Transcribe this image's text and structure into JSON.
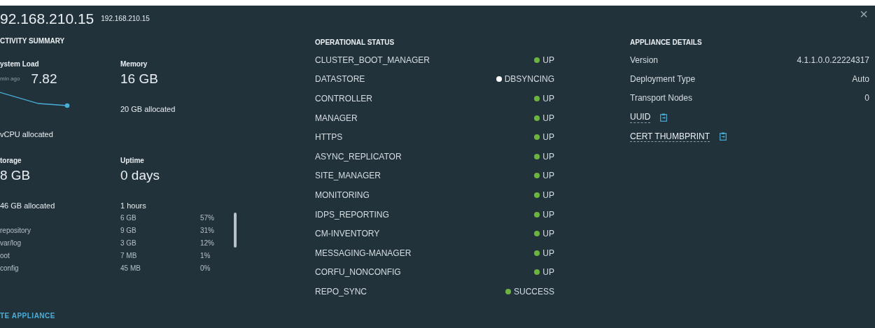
{
  "dialog": {
    "title": "92.168.210.15",
    "subtitle": "192.168.210.15",
    "close": "×"
  },
  "activity_summary": {
    "heading": "CTIVITY SUMMARY",
    "system_load": {
      "label": "ystem Load",
      "time": "min ago",
      "value": "7.82",
      "note": "vCPU allocated"
    },
    "memory": {
      "label": "Memory",
      "value": "16 GB",
      "note": "20 GB allocated"
    },
    "storage": {
      "label": "torage",
      "value": "8 GB",
      "note": "46 GB allocated"
    },
    "uptime": {
      "label": "Uptime",
      "value": "0 days",
      "note": "1 hours"
    },
    "partitions": [
      {
        "size": "6 GB",
        "percent": "57%"
      },
      {
        "name": "repository",
        "size": "9 GB",
        "percent": "31%"
      },
      {
        "name": "var/log",
        "size": "3 GB",
        "percent": "12%"
      },
      {
        "name": "oot",
        "size": "7 MB",
        "percent": "1%"
      },
      {
        "name": "config",
        "size": "45 MB",
        "percent": "0%"
      }
    ],
    "action": "TE APPLIANCE"
  },
  "operational_status": {
    "heading": "OPERATIONAL STATUS",
    "items": [
      {
        "name": "CLUSTER_BOOT_MANAGER",
        "status": "UP",
        "color": "#6db33f"
      },
      {
        "name": "DATASTORE",
        "status": "DBSYNCING",
        "color": "#ffffff"
      },
      {
        "name": "CONTROLLER",
        "status": "UP",
        "color": "#6db33f"
      },
      {
        "name": "MANAGER",
        "status": "UP",
        "color": "#6db33f"
      },
      {
        "name": "HTTPS",
        "status": "UP",
        "color": "#6db33f"
      },
      {
        "name": "ASYNC_REPLICATOR",
        "status": "UP",
        "color": "#6db33f"
      },
      {
        "name": "SITE_MANAGER",
        "status": "UP",
        "color": "#6db33f"
      },
      {
        "name": "MONITORING",
        "status": "UP",
        "color": "#6db33f"
      },
      {
        "name": "IDPS_REPORTING",
        "status": "UP",
        "color": "#6db33f"
      },
      {
        "name": "CM-INVENTORY",
        "status": "UP",
        "color": "#6db33f"
      },
      {
        "name": "MESSAGING-MANAGER",
        "status": "UP",
        "color": "#6db33f"
      },
      {
        "name": "CORFU_NONCONFIG",
        "status": "UP",
        "color": "#6db33f"
      },
      {
        "name": "REPO_SYNC",
        "status": "SUCCESS",
        "color": "#6db33f"
      }
    ]
  },
  "appliance_details": {
    "heading": "APPLIANCE DETAILS",
    "rows": [
      {
        "label": "Version",
        "value": "4.1.1.0.0.22224317"
      },
      {
        "label": "Deployment Type",
        "value": "Auto"
      },
      {
        "label": "Transport Nodes",
        "value": "0"
      }
    ],
    "copy_fields": [
      {
        "label": "UUID"
      },
      {
        "label": "CERT THUMBPRINT"
      }
    ]
  }
}
